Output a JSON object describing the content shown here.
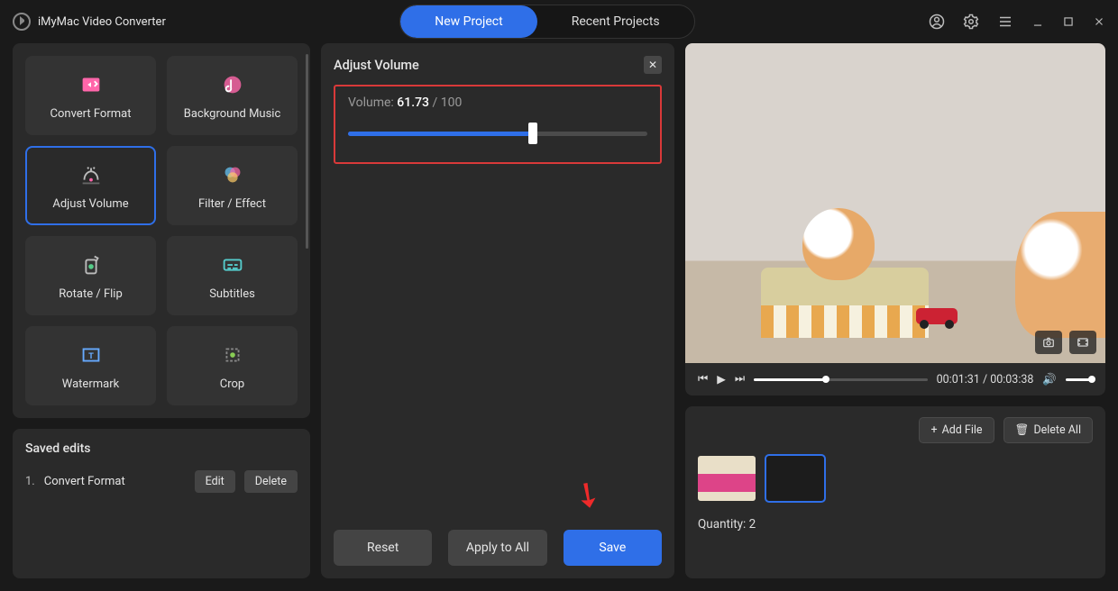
{
  "app": {
    "title": "iMyMac Video Converter"
  },
  "header": {
    "new_project": "New Project",
    "recent_projects": "Recent Projects"
  },
  "tools": [
    {
      "id": "convert-format",
      "label": "Convert Format"
    },
    {
      "id": "background-music",
      "label": "Background Music"
    },
    {
      "id": "adjust-volume",
      "label": "Adjust Volume",
      "active": true
    },
    {
      "id": "filter-effect",
      "label": "Filter / Effect"
    },
    {
      "id": "rotate-flip",
      "label": "Rotate / Flip"
    },
    {
      "id": "subtitles",
      "label": "Subtitles"
    },
    {
      "id": "watermark",
      "label": "Watermark"
    },
    {
      "id": "crop",
      "label": "Crop"
    }
  ],
  "saved_edits": {
    "heading": "Saved edits",
    "items": [
      {
        "n": "1.",
        "name": "Convert Format"
      }
    ],
    "edit_label": "Edit",
    "delete_label": "Delete"
  },
  "adjust_panel": {
    "title": "Adjust Volume",
    "volume_label": "Volume:",
    "volume_value": "61.73",
    "volume_max": "100",
    "volume_percent": 61.73,
    "reset": "Reset",
    "apply_all": "Apply to All",
    "save": "Save"
  },
  "preview": {
    "time_current": "00:01:31",
    "time_total": "00:03:38",
    "progress_percent": 41.7
  },
  "files": {
    "add_label": "Add File",
    "delete_all_label": "Delete All",
    "quantity_label": "Quantity:",
    "quantity_value": "2",
    "selected_index": 1
  }
}
